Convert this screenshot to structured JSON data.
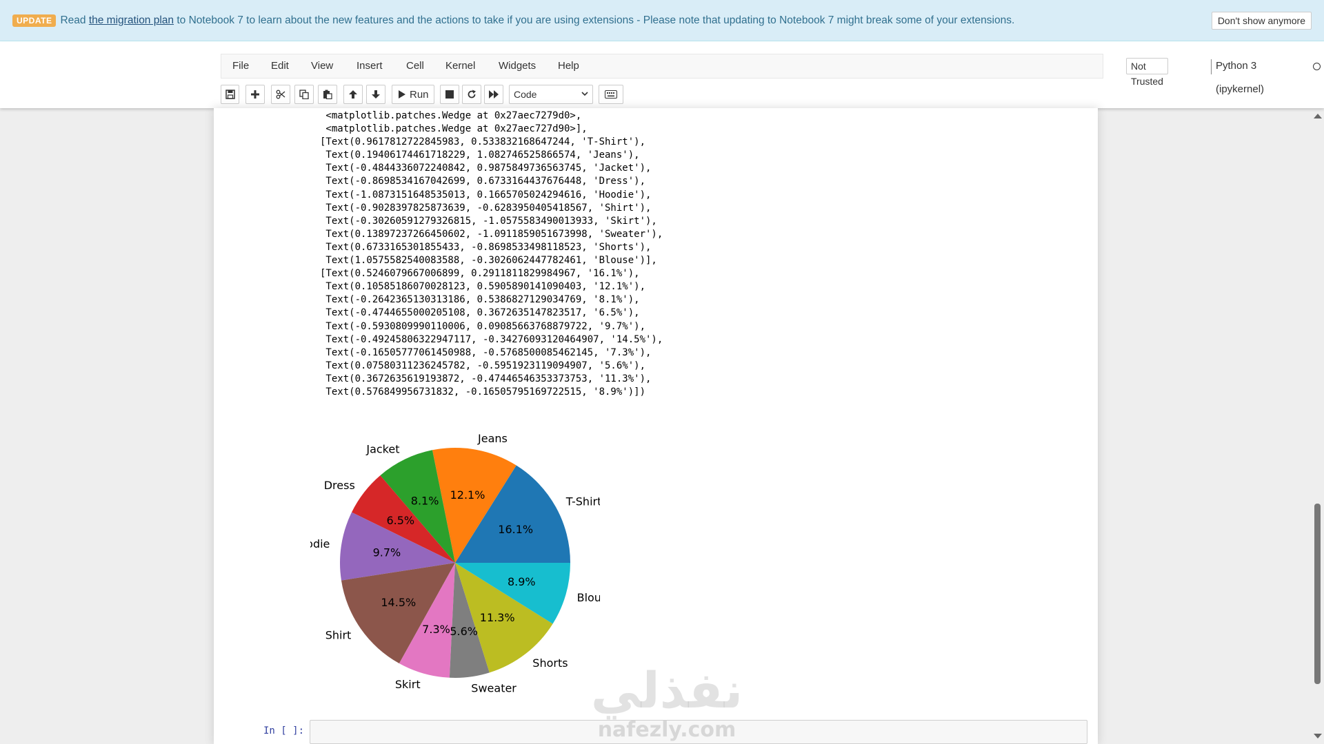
{
  "banner": {
    "badge": "UPDATE",
    "text_before": "Read ",
    "link": "the migration plan",
    "text_after": " to Notebook 7 to learn about the new features and the actions to take if you are using extensions - Please note that updating to Notebook 7 might break some of your extensions.",
    "dismiss": "Don't show anymore"
  },
  "menu": {
    "items": [
      "File",
      "Edit",
      "View",
      "Insert",
      "Cell",
      "Kernel",
      "Widgets",
      "Help"
    ],
    "trust": "Not Trusted",
    "kernel": "Python 3 (ipykernel)"
  },
  "toolbar": {
    "run_label": "Run",
    "cell_type": "Code",
    "icons": [
      "save-icon",
      "plus-icon",
      "cut-icon",
      "copy-icon",
      "paste-icon",
      "arrow-up-icon",
      "arrow-down-icon",
      "play-icon",
      "stop-icon",
      "restart-icon",
      "fast-forward-icon",
      "keyboard-icon"
    ]
  },
  "output": {
    "lines": [
      " <matplotlib.patches.Wedge at 0x27aec7279d0>,",
      " <matplotlib.patches.Wedge at 0x27aec727d90>],",
      "[Text(0.9617812722845983, 0.533832168647244, 'T-Shirt'),",
      " Text(0.19406174461718229, 1.082746525866574, 'Jeans'),",
      " Text(-0.4844336072240842, 0.9875849736563745, 'Jacket'),",
      " Text(-0.8698534167042699, 0.6733164437676448, 'Dress'),",
      " Text(-1.0873151648535013, 0.1665705024294616, 'Hoodie'),",
      " Text(-0.9028397825873639, -0.6283950405418567, 'Shirt'),",
      " Text(-0.30260591279326815, -1.0575583490013933, 'Skirt'),",
      " Text(0.13897237266450602, -1.0911859051673998, 'Sweater'),",
      " Text(0.6733165301855433, -0.8698533498118523, 'Shorts'),",
      " Text(1.0575582540083588, -0.3026062447782461, 'Blouse')],",
      "[Text(0.5246079667006899, 0.2911811829984967, '16.1%'),",
      " Text(0.10585186070028123, 0.5905890141090403, '12.1%'),",
      " Text(-0.2642365130313186, 0.5386827129034769, '8.1%'),",
      " Text(-0.4744655000205108, 0.3672635147823517, '6.5%'),",
      " Text(-0.5930809990110006, 0.09085663768879722, '9.7%'),",
      " Text(-0.49245806322947117, -0.34276093120464907, '14.5%'),",
      " Text(-0.16505777061450988, -0.5768500085462145, '7.3%'),",
      " Text(0.07580311236245782, -0.5951923119094907, '5.6%'),",
      " Text(0.3672635619193872, -0.47446546353373753, '11.3%'),",
      " Text(0.576849956731832, -0.16505795169722515, '8.9%')])"
    ]
  },
  "chart_data": {
    "type": "pie",
    "labels": [
      "T-Shirt",
      "Jeans",
      "Jacket",
      "Dress",
      "Hoodie",
      "Shirt",
      "Skirt",
      "Sweater",
      "Shorts",
      "Blouse"
    ],
    "values": [
      16.1,
      12.1,
      8.1,
      6.5,
      9.7,
      14.5,
      7.3,
      5.6,
      11.3,
      8.9
    ],
    "autopct_labels": [
      "16.1%",
      "12.1%",
      "8.1%",
      "6.5%",
      "9.7%",
      "14.5%",
      "7.3%",
      "5.6%",
      "11.3%",
      "8.9%"
    ],
    "colors": [
      "#1f77b4",
      "#ff7f0e",
      "#2ca02c",
      "#d62728",
      "#9467bd",
      "#8c564b",
      "#e377c2",
      "#7f7f7f",
      "#bcbd22",
      "#17becf"
    ],
    "start_angle_deg": 0,
    "direction": "counterclockwise",
    "title": ""
  },
  "input_cell": {
    "prompt": "In [ ]:"
  },
  "watermark": {
    "arabic": "نفذلي",
    "latin": "nafezly.com"
  }
}
